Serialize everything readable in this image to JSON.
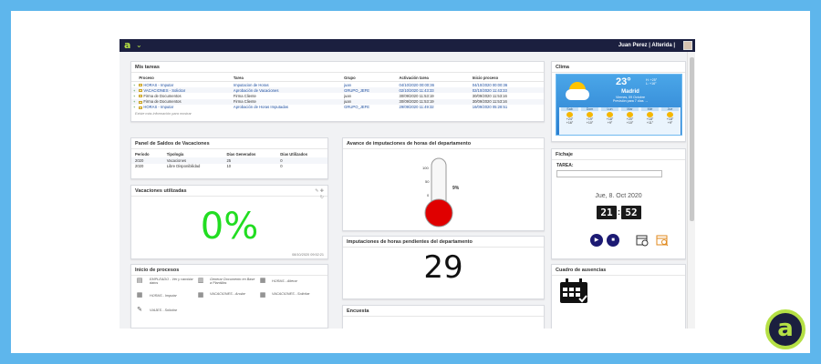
{
  "header": {
    "brand": "a",
    "user_label": "Juan Perez | Alterida |"
  },
  "mis_tareas": {
    "title": "Mis tareas",
    "columns": [
      "Proceso",
      "Tarea",
      "Grupo",
      "Activación tarea",
      "Inicio proceso"
    ],
    "rows": [
      [
        "HORAS - Imputar",
        "Imputacion de Horas",
        "juan",
        "04/10/2020 00:00:36",
        "04/10/2020 00:00:36"
      ],
      [
        "VACACIONES - Solicitar",
        "Aprobación de Vacaciones",
        "GRUPO_JEFE",
        "02/10/2020 11:43:33",
        "02/10/2020 11:43:33"
      ],
      [
        "Firma de Documentos",
        "Firma Cliente",
        "juan",
        "30/09/2020 11:53:19",
        "30/09/2020 11:53:16"
      ],
      [
        "Firma de Documentos",
        "Firma Cliente",
        "juan",
        "30/09/2020 11:53:19",
        "30/09/2020 11:53:16"
      ],
      [
        "HORAS - Imputar",
        "Aprobación de Horas Imputadas",
        "GRUPO_JEFE",
        "29/09/2020 11:49:32",
        "16/09/2020 05:28:51"
      ]
    ],
    "footnote": "Existe más información para mostrar"
  },
  "saldos": {
    "title": "Panel de Saldos de Vacaciones",
    "columns": [
      "Periodo",
      "Tipología",
      "Días Generados",
      "Días Utilizados"
    ],
    "rows": [
      [
        "2020",
        "Vacaciones",
        "25",
        "0"
      ],
      [
        "2020",
        "Libre Disponibilidad",
        "10",
        "0"
      ]
    ]
  },
  "vacaciones": {
    "title": "Vacaciones utilizadas",
    "value": "0%",
    "timestamp": "08/10/2020 09:52:21"
  },
  "inicio_procesos": {
    "title": "Inicio de procesos",
    "items": [
      {
        "label": "EMPLEADO - Ver y cambiar datos",
        "icon": "id-card-icon"
      },
      {
        "label": "Generar Documento en Base a Plantillas",
        "icon": "document-icon"
      },
      {
        "label": "HORAS - Alterar",
        "icon": "calendar-icon"
      },
      {
        "label": "HORAS - Imputar",
        "icon": "calendar-icon"
      },
      {
        "label": "VACACIONES - Anular",
        "icon": "calendar-cancel-icon"
      },
      {
        "label": "VACACIONES - Solicitar",
        "icon": "calendar-add-icon"
      },
      {
        "label": "VIAJES - Solicitar",
        "icon": "pencil-icon"
      }
    ]
  },
  "avance": {
    "title": "Avance de imputaciones de horas del departamento",
    "scale": [
      "100",
      "50",
      "0"
    ],
    "value_label": "9%",
    "fill_fraction": 0.09
  },
  "pendientes": {
    "title": "Imputaciones de horas pendientes del departamento",
    "value": "29"
  },
  "encuesta": {
    "title": "Encuesta"
  },
  "clima": {
    "title": "Clima",
    "temp": "23°",
    "range": "H: +25°\nL: +16°",
    "city": "Madrid",
    "date_line1": "Viernes, 09 Octubre",
    "date_line2": "Previsión para 7 días →",
    "days": [
      {
        "name": "Sab",
        "hi": "+24°",
        "lo": "+16°"
      },
      {
        "name": "Dom",
        "hi": "+19°",
        "lo": "+10°"
      },
      {
        "name": "Lun",
        "hi": "+18°",
        "lo": "+9°"
      },
      {
        "name": "Mar",
        "hi": "+20°",
        "lo": "+10°"
      },
      {
        "name": "Mié",
        "hi": "+18°",
        "lo": "+11°"
      },
      {
        "name": "Jue",
        "hi": "+18°",
        "lo": "+9°"
      }
    ]
  },
  "fichaje": {
    "title": "Fichaje",
    "tarea_label": "TAREA:",
    "date": "Jue, 8. Oct 2020",
    "hours": "21",
    "minutes": "52"
  },
  "ausencias": {
    "title": "Cuadro de ausencias"
  },
  "colors": {
    "accent": "#b5e045",
    "navy": "#1b1f3f",
    "percent_green": "#22dd22",
    "thermo_red": "#e00000"
  }
}
